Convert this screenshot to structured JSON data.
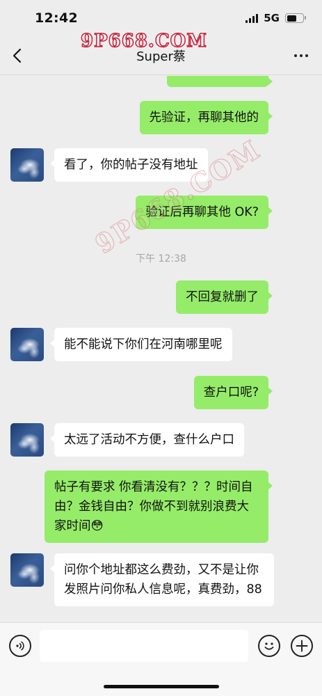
{
  "status_bar": {
    "time": "12:42",
    "network": "5G",
    "signal_bars": 4,
    "battery_level": 0.6
  },
  "header": {
    "title": "Super蔡",
    "watermark": "9P668.COM",
    "watermark_diagonal": "9P668.COM"
  },
  "messages": [
    {
      "side": "out",
      "text": ""
    },
    {
      "side": "out",
      "text": "先验证，再聊其他的"
    },
    {
      "side": "in",
      "text": "看了，你的帖子没有地址"
    },
    {
      "side": "out",
      "text": "验证后再聊其他 OK?"
    },
    {
      "type": "time",
      "text": "下午 12:38"
    },
    {
      "side": "out",
      "text": "不回复就删了"
    },
    {
      "side": "in",
      "text": "能不能说下你们在河南哪里呢"
    },
    {
      "side": "out",
      "text": "查户口呢?"
    },
    {
      "side": "in",
      "text": "太远了活动不方便，查什么户口"
    },
    {
      "side": "out",
      "text": "帖子有要求 你看清没有？？？时间自由？金钱自由？你做不到就别浪费大家时间😳"
    },
    {
      "side": "in",
      "text": "问你个地址都这么费劲，又不是让你发照片问你私人信息呢，真费劲，88"
    }
  ],
  "input": {
    "placeholder": ""
  },
  "colors": {
    "outgoing_bubble": "#95ec69",
    "incoming_bubble": "#ffffff",
    "background": "#ededed"
  }
}
